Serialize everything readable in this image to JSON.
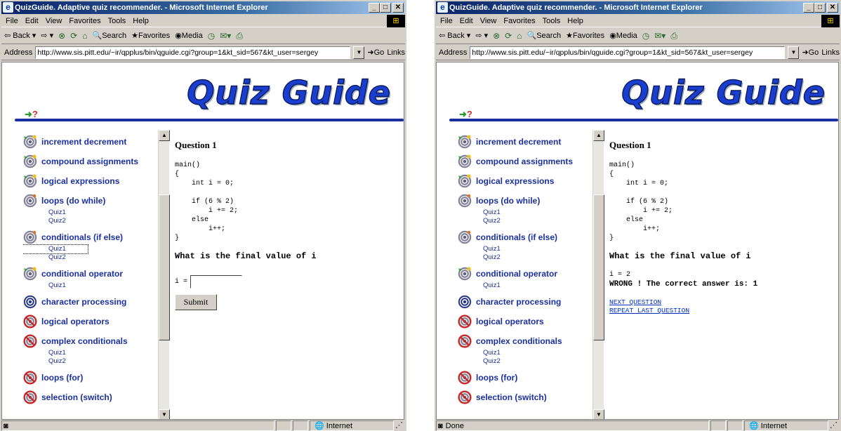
{
  "window": {
    "title": "QuizGuide. Adaptive quiz recommender. - Microsoft Internet Explorer",
    "menu": [
      "File",
      "Edit",
      "View",
      "Favorites",
      "Tools",
      "Help"
    ],
    "toolbar": [
      "Back",
      "Search",
      "Favorites",
      "Media"
    ],
    "address_label": "Address",
    "url": "http://www.sis.pitt.edu/~ir/qpplus/bin/qguide.cgi?group=1&kt_sid=567&kt_user=sergey",
    "go_label": "Go",
    "links_label": "Links",
    "zone": "Internet",
    "status_done": "Done"
  },
  "logo": {
    "text": "Quiz Guide",
    "mark": "?"
  },
  "topics": [
    {
      "label": "increment decrement",
      "target": "sun-icon",
      "subs": []
    },
    {
      "label": "compound assignments",
      "target": "sun-icon",
      "subs": []
    },
    {
      "label": "logical expressions",
      "target": "sun-icon",
      "subs": []
    },
    {
      "label": "loops (do while)",
      "target": "target-icon",
      "subs": [
        "Quiz1",
        "Quiz2"
      ]
    },
    {
      "label": "conditionals (if else)",
      "target": "target-icon",
      "subs": [
        "Quiz1",
        "Quiz2"
      ]
    },
    {
      "label": "conditional operator",
      "target": "sun-icon",
      "subs": [
        "Quiz1"
      ]
    },
    {
      "label": "character processing",
      "target": "target-blue-icon",
      "subs": []
    },
    {
      "label": "logical operators",
      "target": "blocked-target-icon",
      "subs": []
    },
    {
      "label": "complex conditionals",
      "target": "blocked-target-icon",
      "subs": [
        "Quiz1",
        "Quiz2"
      ]
    },
    {
      "label": "loops (for)",
      "target": "blocked-target-icon",
      "subs": []
    },
    {
      "label": "selection (switch)",
      "target": "blocked-target-icon",
      "subs": []
    }
  ],
  "question": {
    "title": "Question 1",
    "code": "main()\n{\n    int i = 0;\n\n    if (6 % 2)\n        i += 2;\n    else\n        i++;\n}",
    "prompt": "What is the final value of i",
    "input_label": "i =",
    "submit_label": "Submit",
    "given_answer": "i = 2",
    "feedback": "WRONG ! The correct answer is: 1",
    "next_link": "NEXT QUESTION",
    "repeat_link": "REPEAT LAST QUESTION"
  },
  "colors": {
    "link": "#1a2fa0",
    "title_bar": "#0a246a",
    "logo": "#1a3fd0"
  }
}
